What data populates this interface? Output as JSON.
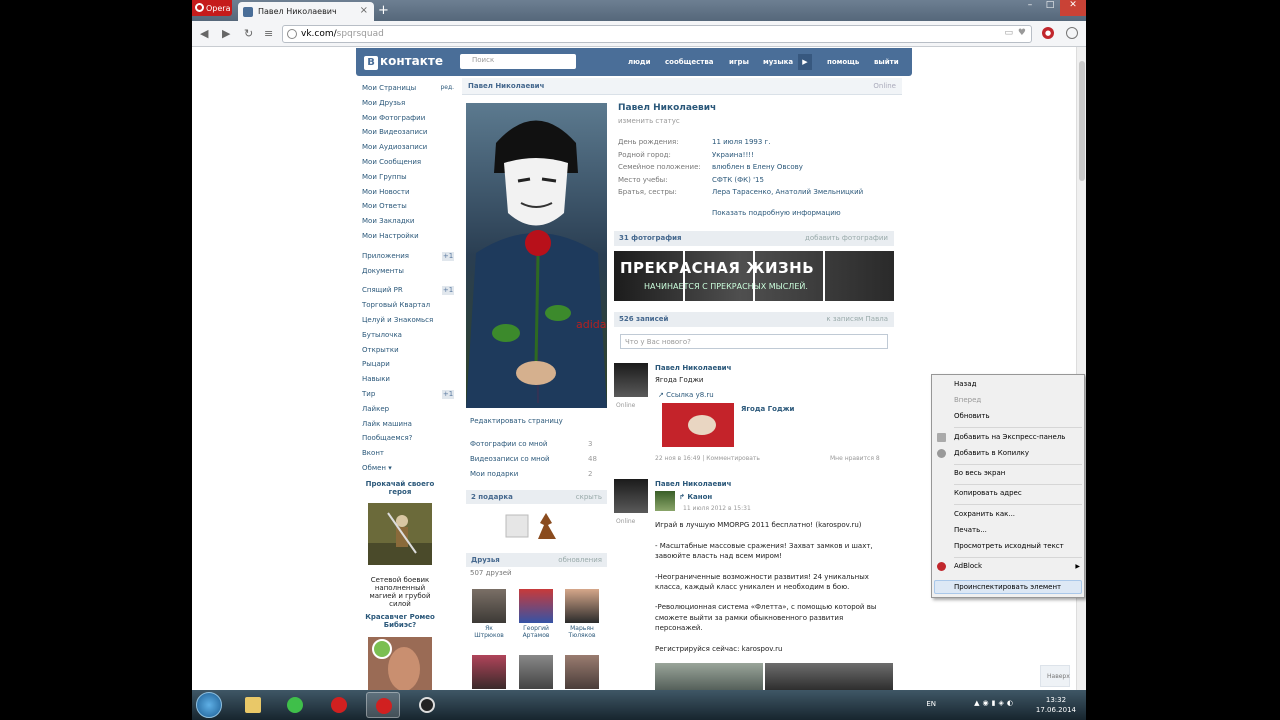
{
  "browser": {
    "menu_label": "Opera",
    "tab_title": "Павел Николаевич",
    "url_domain": "vk.com/",
    "url_path": "spqrsquad"
  },
  "vk": {
    "logo": "контакте",
    "logo_box": "В",
    "search_placeholder": "Поиск",
    "nav": [
      "люди",
      "сообщества",
      "игры",
      "музыка",
      "помощь",
      "выйти"
    ]
  },
  "left_menu": {
    "items": [
      {
        "label": "Мои Страницы",
        "extra": "ред."
      },
      {
        "label": "Мои Друзья"
      },
      {
        "label": "Мои Фотографии"
      },
      {
        "label": "Мои Видеозаписи"
      },
      {
        "label": "Мои Аудиозаписи"
      },
      {
        "label": "Мои Сообщения"
      },
      {
        "label": "Мои Группы"
      },
      {
        "label": "Мои Новости"
      },
      {
        "label": "Мои Ответы"
      },
      {
        "label": "Мои Закладки"
      },
      {
        "label": "Мои Настройки"
      }
    ],
    "apps": [
      {
        "label": "Приложения",
        "extra": "+1"
      },
      {
        "label": "Документы"
      }
    ],
    "games": [
      {
        "label": "Спящий PR",
        "extra": "+1"
      },
      {
        "label": "Торговый Квартал"
      },
      {
        "label": "Целуй и Знакомься"
      },
      {
        "label": "Бутылочка"
      },
      {
        "label": "Открытки"
      },
      {
        "label": "Рыцари"
      },
      {
        "label": "Навыки"
      },
      {
        "label": "Тир",
        "extra": "+1"
      },
      {
        "label": "Лайкер"
      },
      {
        "label": "Лайк машина"
      },
      {
        "label": "Пообщаемся?"
      },
      {
        "label": "Вконт"
      },
      {
        "label": "Обмен ▾"
      }
    ],
    "ad1_title": "Прокачай своего героя",
    "ad1_text": "Сетевой боевик наполненный магией и грубой силой",
    "ad2_title": "Красавчег Ромеo Бибиэс?"
  },
  "profile": {
    "header_name": "Павел Николаевич",
    "header_right": "Online",
    "name": "Павел Николаевич",
    "status": "изменить статус",
    "info": [
      {
        "label": "День рождения:",
        "value": "11 июля 1993 г."
      },
      {
        "label": "Родной город:",
        "value": "Украина!!!!"
      },
      {
        "label": "Семейное положение:",
        "value": "влюблен в Елену Овсову"
      },
      {
        "label": "Место учебы:",
        "value": "СФТК (ФК) '15"
      },
      {
        "label": "Братья, сестры:",
        "value": "Лера Тарасенко, Анатолий Змельницкий"
      }
    ],
    "more_info": "Показать подробную информацию",
    "edit_page": "Редактировать страницу",
    "side_links": [
      {
        "label": "Фотографии со мной",
        "count": "3"
      },
      {
        "label": "Видеозаписи со мной",
        "count": "48"
      },
      {
        "label": "Мои подарки",
        "count": "2"
      }
    ],
    "gifts_head": "2 подарка",
    "gifts_right": "скрыть",
    "friends_head": "Друзья",
    "friends_right": "обновления",
    "friends_count": "507 друзей",
    "friends": [
      "Як Штрюков",
      "Георгий Артамов",
      "Марьян Тюляков"
    ],
    "photos_head": "31 фотография",
    "photos_right": "добавить фотографии",
    "banner_t1": "ПРЕКРАСНАЯ ЖИЗНЬ",
    "banner_t2": "НАЧИНАЕТСЯ С ПРЕКРАСНЫХ МЫСЛЕЙ.",
    "wall_head": "526 записей",
    "wall_right": "к записям Павла",
    "wall_placeholder": "Что у Вас нового?",
    "posts": [
      {
        "author": "Павел Николаевич",
        "online": "Online",
        "text": "Ягода Годжи",
        "link": "Ссылка y8.ru",
        "title": "Ягода Годжи",
        "meta": "22 ноя в 16:49 | Комментировать",
        "likes": "Мне нравится 8"
      },
      {
        "author": "Павел Николаевич",
        "online": "Online",
        "repost": "Канон",
        "date": "11 июля 2012 в 15:31",
        "lines": [
          "Играй в лучшую MMORPG 2011 бесплатно! (karospov.ru)",
          "",
          "- Масштабные массовые сражения! Захват замков и шахт,",
          "завоюйте власть над всем миром!",
          "",
          "-Неограниченные возможности развития! 24 уникальных",
          "класса, каждый класс уникален и необходим в бою.",
          "",
          "-Революционная система «Флетта», с помощью которой вы",
          "сможете выйти за рамки обыкновенного развития",
          "персонажей.",
          "",
          "Регистрируйся сейчас: karospov.ru"
        ]
      }
    ],
    "back_to_top": "Наверх"
  },
  "context_menu": {
    "items": [
      "Назад",
      "Вперед",
      "Обновить",
      "Добавить на Экспресс-панель",
      "Добавить в Копилку",
      "Во весь экран",
      "Копировать адрес",
      "Сохранить как...",
      "Печать...",
      "Просмотреть исходный текст",
      "AdBlock",
      "Проинспектировать элемент"
    ]
  },
  "taskbar": {
    "lang": "EN",
    "time": "13:32",
    "date": "17.06.2014"
  },
  "colors": {
    "vk_blue": "#4a6e98",
    "link": "#2b587a",
    "opera_red": "#c51b1b"
  }
}
